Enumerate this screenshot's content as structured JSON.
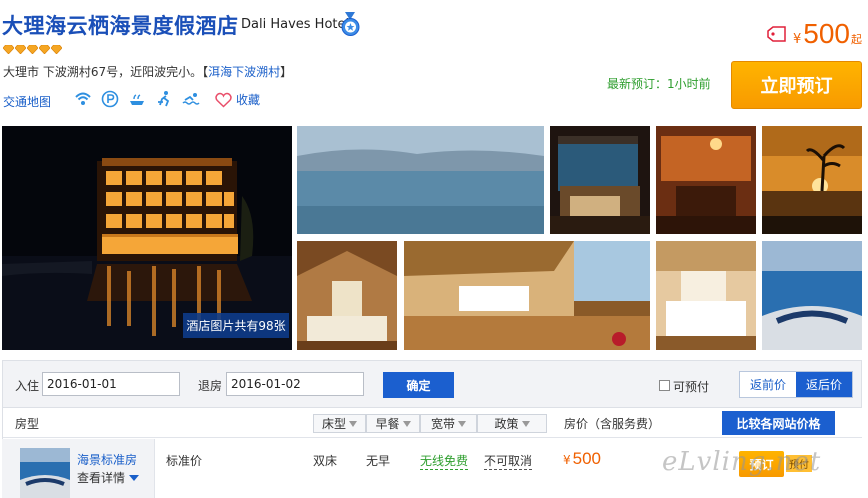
{
  "hotel": {
    "name_cn": "大理海云栖海景度假酒店",
    "name_en": "Dali Haves Hotel",
    "diamond_count": 5,
    "address_prefix": "大理市 下波溯村67号，近阳波完小。【",
    "address_link": "洱海下波溯村",
    "address_suffix": "】",
    "traffic_map": "交通地图",
    "favorite": "收藏",
    "amenity_icons": [
      "wifi-icon",
      "parking-icon",
      "restaurant-icon",
      "gym-icon",
      "swimming-icon"
    ]
  },
  "price": {
    "currency": "¥",
    "amount": "500",
    "suffix": "起"
  },
  "latest_booking": "最新预订：1小时前",
  "book_now": "立即预订",
  "photos": {
    "count_label": "酒店图片共有98张"
  },
  "search": {
    "checkin_label": "入住",
    "checkin_value": "2016-01-01",
    "checkout_label": "退房",
    "checkout_value": "2016-01-02",
    "confirm": "确定",
    "prepay_label": "可预付",
    "prepay_checked": false,
    "toggle_before": "返前价",
    "toggle_after": "返后价",
    "toggle_active": "返后价"
  },
  "table": {
    "room_type_header": "房型",
    "filters": [
      "床型",
      "早餐",
      "宽带",
      "政策"
    ],
    "price_header": "房价（含服务费）",
    "compare_btn": "比较各网站价格"
  },
  "room": {
    "name": "海景标准房",
    "detail": "查看详情",
    "rate_plan": "标准价",
    "bed": "双床",
    "breakfast": "无早",
    "broadband": "无线免费",
    "policy": "不可取消",
    "currency": "¥",
    "price": "500",
    "book": "预订",
    "tag": "预付"
  },
  "watermark": "eLvling.net",
  "colors": {
    "brand_blue": "#1a4fb8",
    "link_blue": "#1a5fc9",
    "button_blue": "#1b5fcf",
    "price_orange": "#f06000",
    "book_orange": "#f89a00",
    "green": "#2e9e2e"
  }
}
